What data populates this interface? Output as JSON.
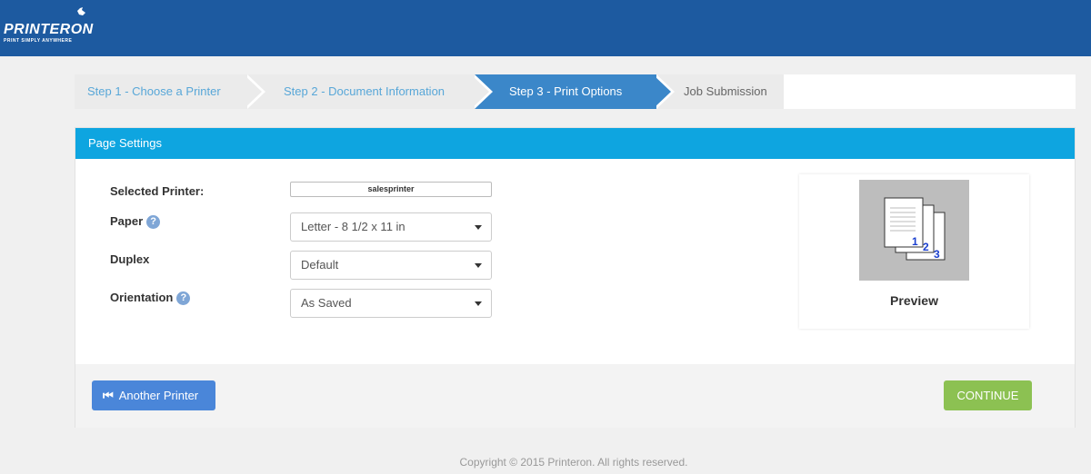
{
  "header": {
    "brand": "PRINTERON",
    "tagline": "PRINT SIMPLY ANYWHERE"
  },
  "steps": [
    {
      "label": "Step 1 - Choose a Printer",
      "state": "done"
    },
    {
      "label": "Step 2 - Document Information",
      "state": "done"
    },
    {
      "label": "Step 3 - Print Options",
      "state": "active"
    },
    {
      "label": "Job Submission",
      "state": "pending"
    }
  ],
  "panel": {
    "title": "Page Settings",
    "fields": {
      "printer": {
        "label": "Selected Printer:",
        "value": "salesprinter"
      },
      "paper": {
        "label": "Paper",
        "value": "Letter - 8 1/2 x 11 in"
      },
      "duplex": {
        "label": "Duplex",
        "value": "Default"
      },
      "orientation": {
        "label": "Orientation",
        "value": "As Saved"
      }
    },
    "help_glyph": "?",
    "preview": {
      "label": "Preview",
      "page_numbers": [
        "1",
        "2",
        "3"
      ]
    }
  },
  "buttons": {
    "another_printer": "Another Printer",
    "continue": "CONTINUE"
  },
  "footer": {
    "copyright": "Copyright © 2015 Printeron. All rights reserved."
  },
  "colors": {
    "brand": "#1d5aa0",
    "active_step": "#3b87c9",
    "panel_header": "#0ea5e0",
    "continue": "#8cc152",
    "another": "#4a86d9"
  }
}
